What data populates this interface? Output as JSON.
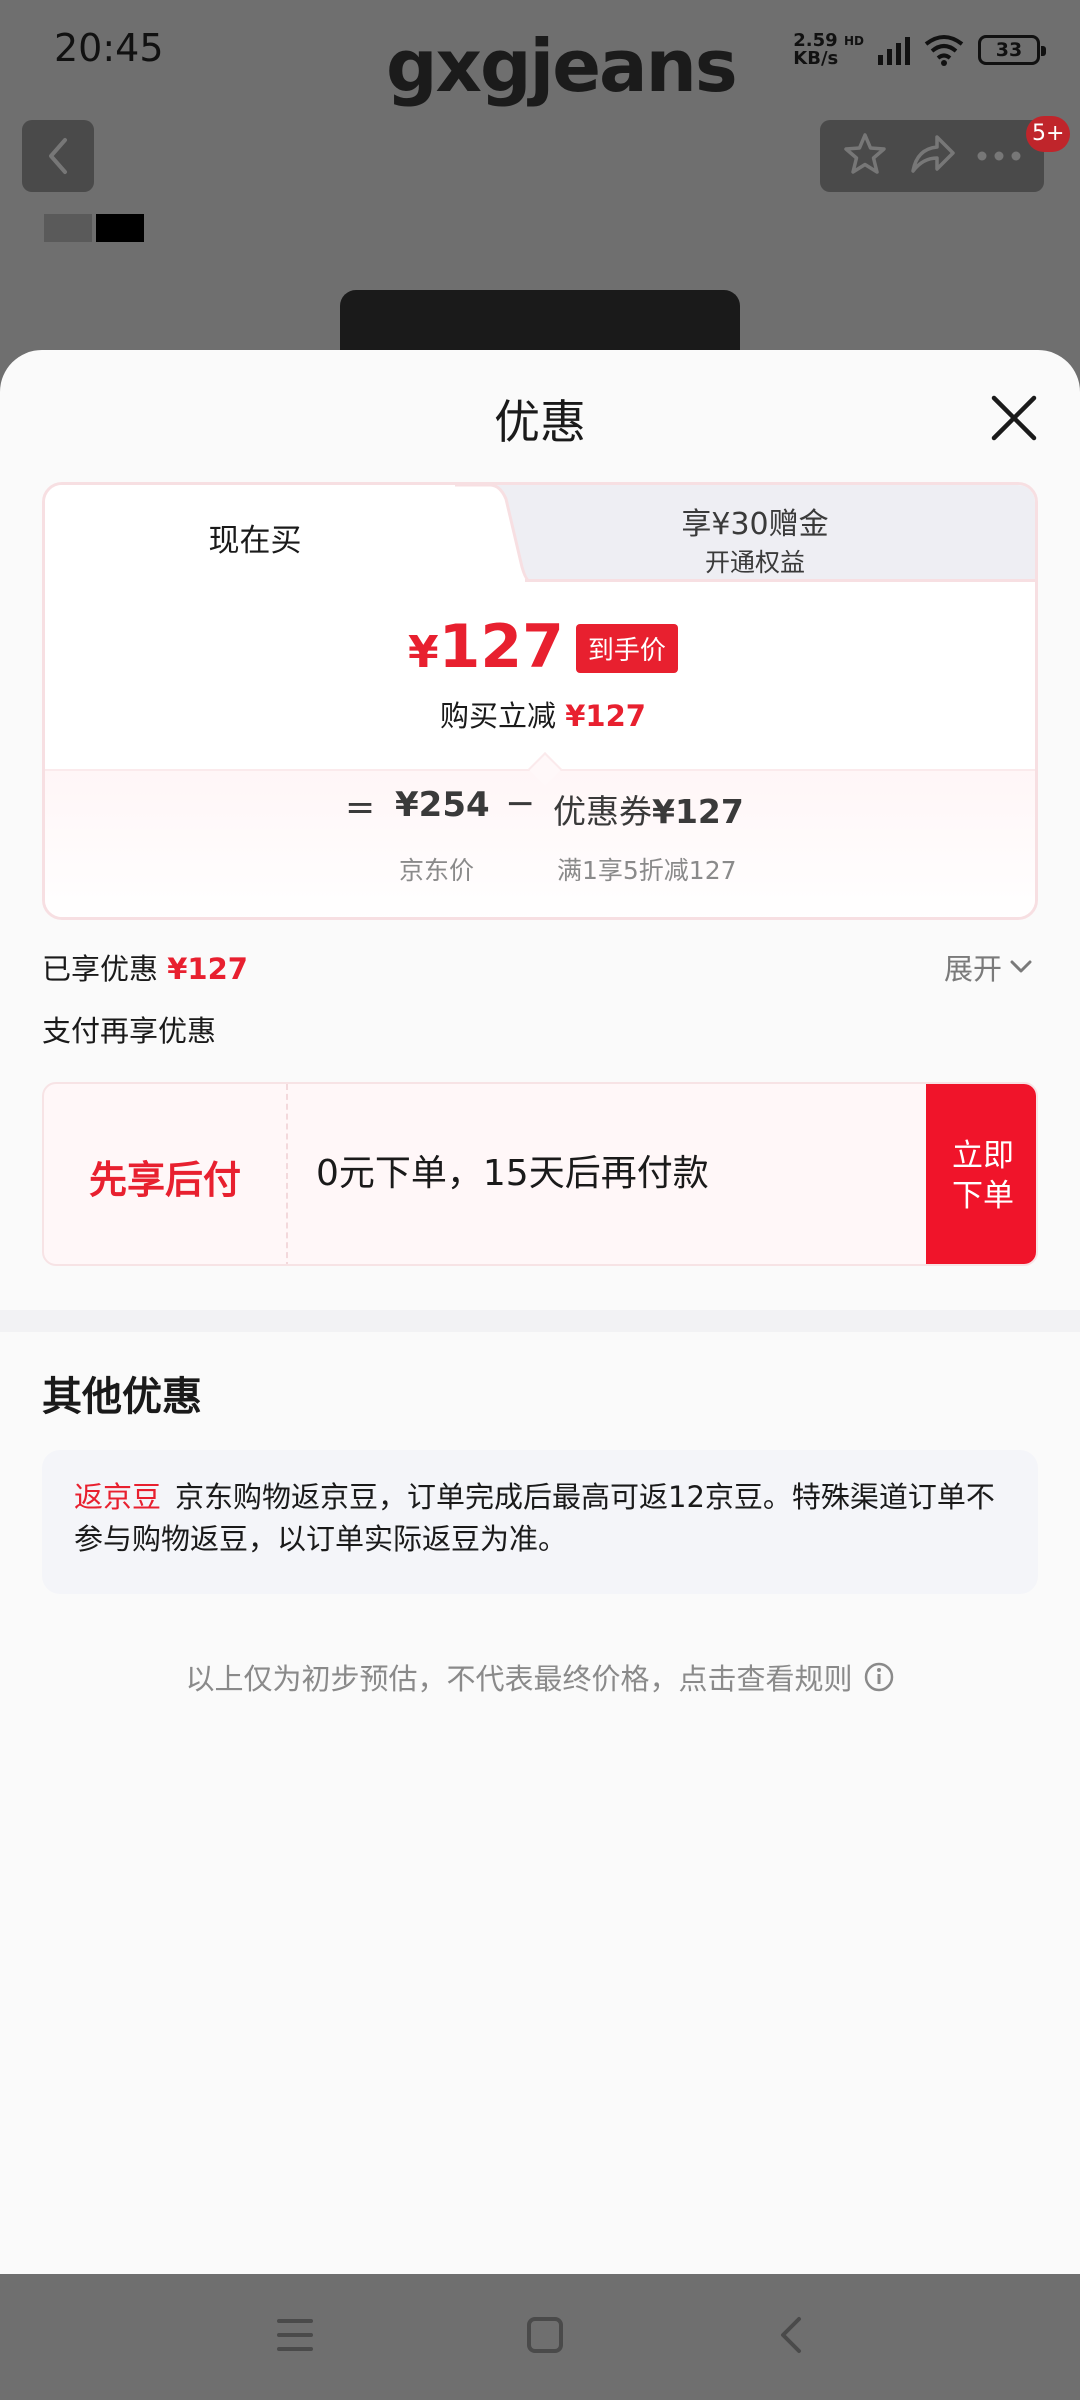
{
  "status_bar": {
    "time": "20:45",
    "net_speed_value": "2.59",
    "net_speed_unit": "KB/s",
    "hd_label": "HD",
    "battery": "33"
  },
  "product_page": {
    "brand": "gxgjeans",
    "cart_badge": "5+"
  },
  "sheet": {
    "title": "优惠",
    "tabs": {
      "active": "现在买",
      "inactive_line1": "享¥30赠金",
      "inactive_line2": "开通权益"
    },
    "final_price": {
      "symbol": "¥",
      "amount": "127",
      "tag": "到手价"
    },
    "reduce": {
      "label": "购买立减",
      "amount": "¥127"
    },
    "formula": {
      "equals": "=",
      "jd_price": "¥254",
      "minus": "−",
      "coupon_label": "优惠券",
      "coupon_amount": "¥127",
      "jd_price_caption": "京东价",
      "coupon_caption": "满1享5折减127"
    },
    "enjoyed": {
      "label": "已享优惠",
      "amount": "¥127",
      "expand": "展开"
    },
    "pay_more_label": "支付再享优惠",
    "bnpl": {
      "title": "先享后付",
      "desc": "0元下单，15天后再付款",
      "button_line1": "立即",
      "button_line2": "下单"
    },
    "other_title": "其他优惠",
    "bean": {
      "tag": "返京豆",
      "text": "京东购物返京豆，订单完成后最高可返12京豆。特殊渠道订单不参与购物返豆，以订单实际返豆为准。"
    },
    "disclaimer": "以上仅为初步预估，不代表最终价格，点击查看规则"
  },
  "colors": {
    "accent_red": "#e8202f",
    "button_red": "#f0142a",
    "overlay": "#6f6f6f"
  }
}
